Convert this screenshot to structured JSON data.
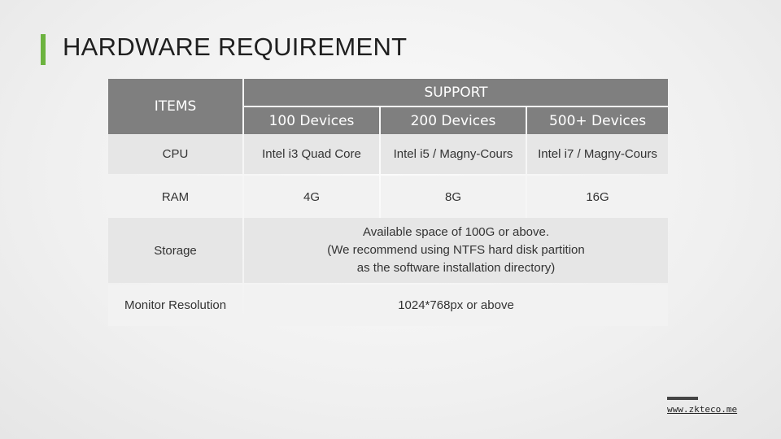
{
  "page": {
    "title": "HARDWARE REQUIREMENT",
    "accent_color": "#6cb33f",
    "footer_link": "www.zkteco.me"
  },
  "table": {
    "items_header": "ITEMS",
    "support_header": "SUPPORT",
    "columns": [
      "100 Devices",
      "200 Devices",
      "500+ Devices"
    ],
    "rows": [
      {
        "item": "CPU",
        "values": [
          "Intel i3 Quad Core",
          "Intel i5 / Magny-Cours",
          "Intel i7 / Magny-Cours"
        ]
      },
      {
        "item": "RAM",
        "values": [
          "4G",
          "8G",
          "16G"
        ]
      },
      {
        "item": "Storage",
        "merged_lines": [
          "Available space of 100G or above.",
          "(We recommend using NTFS hard disk partition",
          "as the software installation directory)"
        ]
      },
      {
        "item": "Monitor Resolution",
        "merged": "1024*768px or above"
      }
    ]
  }
}
